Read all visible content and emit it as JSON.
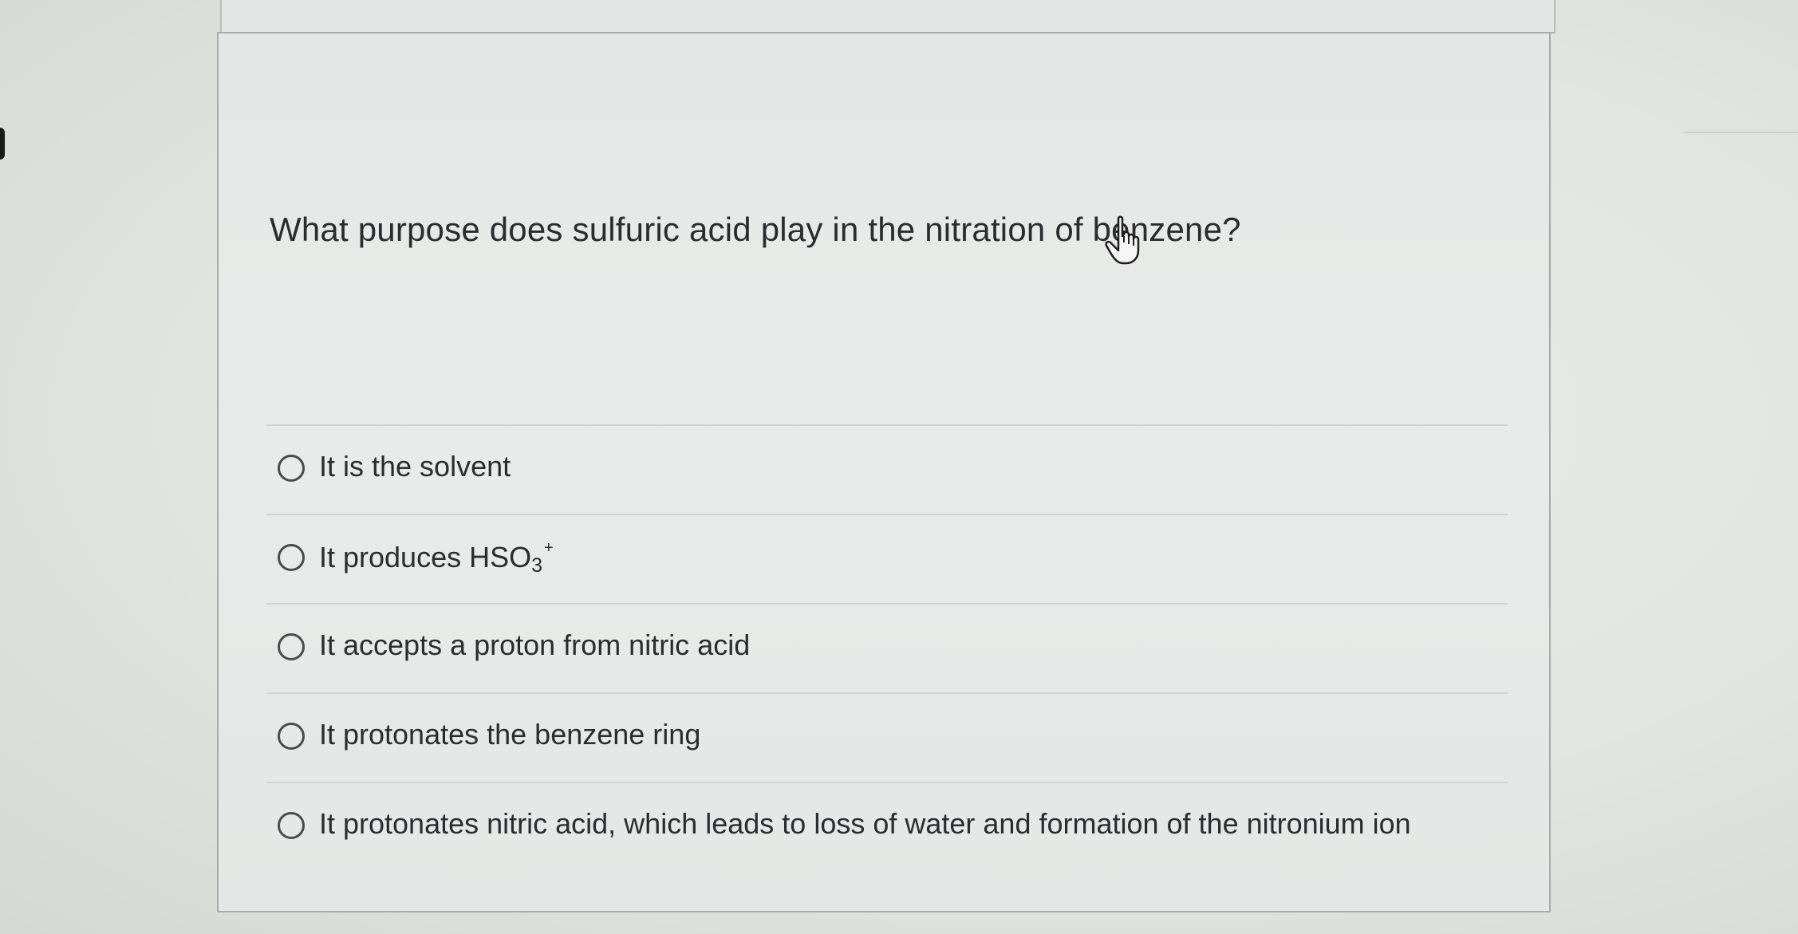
{
  "question": {
    "text": "What purpose does sulfuric acid play in the nitration of benzene?"
  },
  "options": [
    {
      "label": "It is the solvent"
    },
    {
      "label_prefix": "It produces HSO",
      "subscript": "3",
      "superscript": "+"
    },
    {
      "label": "It accepts a proton from nitric acid"
    },
    {
      "label": "It protonates the benzene ring"
    },
    {
      "label": "It protonates nitric acid, which leads to loss of water and formation of the nitronium ion"
    }
  ],
  "icons": {
    "radio": "radio-unselected-icon",
    "cursor": "hand-pointer-cursor-icon"
  },
  "colors": {
    "text": "#2b2c2e",
    "card_border": "#a9abaa",
    "radio_border": "#4a4b4d",
    "divider": "#d2d4d3"
  }
}
